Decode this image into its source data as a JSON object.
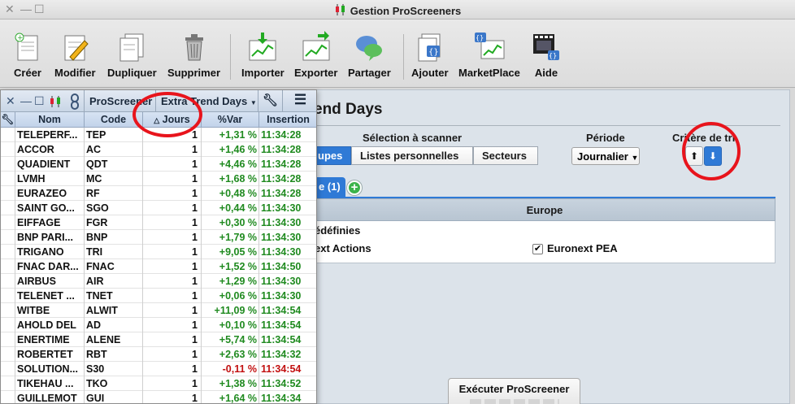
{
  "window": {
    "title": "Gestion ProScreeners"
  },
  "toolbar": {
    "buttons": [
      {
        "label": "Créer",
        "icon": "new-document-icon"
      },
      {
        "label": "Modifier",
        "icon": "edit-document-icon"
      },
      {
        "label": "Dupliquer",
        "icon": "duplicate-icon"
      },
      {
        "label": "Supprimer",
        "icon": "trash-icon"
      },
      {
        "label": "Importer",
        "icon": "import-chart-icon"
      },
      {
        "label": "Exporter",
        "icon": "export-chart-icon"
      },
      {
        "label": "Partager",
        "icon": "share-bubbles-icon"
      },
      {
        "label": "Ajouter",
        "icon": "add-code-icon"
      },
      {
        "label": "MarketPlace",
        "icon": "marketplace-icon"
      },
      {
        "label": "Aide",
        "icon": "help-video-icon"
      }
    ]
  },
  "main": {
    "title": "end Days",
    "selection_label": "Sélection à scanner",
    "period_label": "Période",
    "criteria_label": "Critère de tri",
    "segments": [
      "upes",
      "Listes personnelles",
      "Secteurs"
    ],
    "period_value": "Journalier",
    "tab_label": "e (1)",
    "add_tab": "+",
    "section_title": "Europe",
    "predefined_label": "édéfinies",
    "option_left": "ext Actions",
    "option_right": "Euronext PEA",
    "execute_label": "Exécuter ProScreener"
  },
  "listwin": {
    "tab_screener": "ProScreener",
    "tab_list": "Extra Trend Days",
    "columns": {
      "nom": "Nom",
      "code": "Code",
      "jours": "Jours",
      "var": "%Var",
      "ins": "Insertion"
    },
    "rows": [
      {
        "nom": "TELEPERF...",
        "code": "TEP",
        "jours": "1",
        "var": "+1,31 %",
        "ins": "11:34:28",
        "neg": false
      },
      {
        "nom": "ACCOR",
        "code": "AC",
        "jours": "1",
        "var": "+1,46 %",
        "ins": "11:34:28",
        "neg": false
      },
      {
        "nom": "QUADIENT",
        "code": "QDT",
        "jours": "1",
        "var": "+4,46 %",
        "ins": "11:34:28",
        "neg": false
      },
      {
        "nom": "LVMH",
        "code": "MC",
        "jours": "1",
        "var": "+1,68 %",
        "ins": "11:34:28",
        "neg": false
      },
      {
        "nom": "EURAZEO",
        "code": "RF",
        "jours": "1",
        "var": "+0,48 %",
        "ins": "11:34:28",
        "neg": false
      },
      {
        "nom": "SAINT GO...",
        "code": "SGO",
        "jours": "1",
        "var": "+0,44 %",
        "ins": "11:34:30",
        "neg": false
      },
      {
        "nom": "EIFFAGE",
        "code": "FGR",
        "jours": "1",
        "var": "+0,30 %",
        "ins": "11:34:30",
        "neg": false
      },
      {
        "nom": "BNP PARI...",
        "code": "BNP",
        "jours": "1",
        "var": "+1,79 %",
        "ins": "11:34:30",
        "neg": false
      },
      {
        "nom": "TRIGANO",
        "code": "TRI",
        "jours": "1",
        "var": "+9,05 %",
        "ins": "11:34:30",
        "neg": false
      },
      {
        "nom": "FNAC DAR...",
        "code": "FNAC",
        "jours": "1",
        "var": "+1,52 %",
        "ins": "11:34:50",
        "neg": false
      },
      {
        "nom": "AIRBUS",
        "code": "AIR",
        "jours": "1",
        "var": "+1,29 %",
        "ins": "11:34:30",
        "neg": false
      },
      {
        "nom": "TELENET ...",
        "code": "TNET",
        "jours": "1",
        "var": "+0,06 %",
        "ins": "11:34:30",
        "neg": false
      },
      {
        "nom": "WITBE",
        "code": "ALWIT",
        "jours": "1",
        "var": "+11,09 %",
        "ins": "11:34:54",
        "neg": false
      },
      {
        "nom": "AHOLD DEL",
        "code": "AD",
        "jours": "1",
        "var": "+0,10 %",
        "ins": "11:34:54",
        "neg": false
      },
      {
        "nom": "ENERTIME",
        "code": "ALENE",
        "jours": "1",
        "var": "+5,74 %",
        "ins": "11:34:54",
        "neg": false
      },
      {
        "nom": "ROBERTET",
        "code": "RBT",
        "jours": "1",
        "var": "+2,63 %",
        "ins": "11:34:32",
        "neg": false
      },
      {
        "nom": "SOLUTION...",
        "code": "S30",
        "jours": "1",
        "var": "-0,11 %",
        "ins": "11:34:54",
        "neg": true
      },
      {
        "nom": "TIKEHAU ...",
        "code": "TKO",
        "jours": "1",
        "var": "+1,38 %",
        "ins": "11:34:52",
        "neg": false
      },
      {
        "nom": "GUILLEMOT",
        "code": "GUI",
        "jours": "1",
        "var": "+1,64 %",
        "ins": "11:34:34",
        "neg": false
      }
    ]
  },
  "colors": {
    "accent": "#2f7ad6",
    "positive": "#1f8a1f",
    "negative": "#c21010",
    "annotation": "#e8141c"
  }
}
